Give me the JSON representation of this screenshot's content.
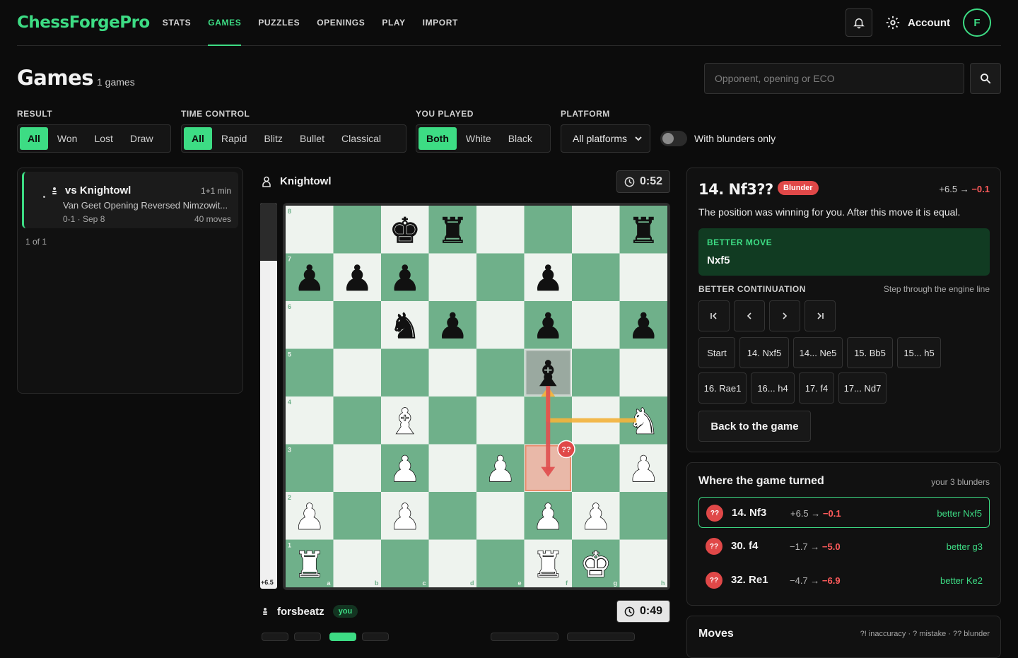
{
  "app": {
    "logo": "ChessForgePro",
    "nav": [
      "STATS",
      "GAMES",
      "PUZZLES",
      "OPENINGS",
      "PLAY",
      "IMPORT"
    ],
    "active_nav": "GAMES",
    "account_label": "Account",
    "avatar_initial": "F",
    "accent": "#3ddc84"
  },
  "page": {
    "title": "Games",
    "count": "1 games",
    "search_placeholder": "Opponent, opening or ECO"
  },
  "filters": {
    "result": {
      "label": "RESULT",
      "options": [
        "All",
        "Won",
        "Lost",
        "Draw"
      ],
      "active": "All"
    },
    "time_control": {
      "label": "TIME CONTROL",
      "options": [
        "All",
        "Rapid",
        "Blitz",
        "Bullet",
        "Classical"
      ],
      "active": "All"
    },
    "you_played": {
      "label": "YOU PLAYED",
      "options": [
        "Both",
        "White",
        "Black"
      ],
      "active": "Both"
    },
    "platform": {
      "label": "PLATFORM",
      "value": "All platforms"
    },
    "blunders_toggle": {
      "label": "With blunders only",
      "on": false
    }
  },
  "games_list": {
    "items": [
      {
        "title": "vs Knightowl",
        "time_control": "1+1 min",
        "opening": "Van Geet Opening Reversed Nimzowit...",
        "meta": "0-1 · Sep 8",
        "moves": "40 moves"
      }
    ],
    "pager": "1 of 1"
  },
  "board": {
    "top_player": {
      "name": "Knightowl",
      "clock": "0:52"
    },
    "bottom_player": {
      "name": "forsbeatz",
      "badge": "you",
      "clock": "0:49"
    },
    "eval_label": "+6.5",
    "eval_white_fraction": 0.85,
    "files": [
      "a",
      "b",
      "c",
      "d",
      "e",
      "f",
      "g",
      "h"
    ],
    "ranks": [
      "8",
      "7",
      "6",
      "5",
      "4",
      "3",
      "2",
      "1"
    ],
    "pieces": [
      {
        "sq": "c8",
        "p": "k"
      },
      {
        "sq": "d8",
        "p": "r"
      },
      {
        "sq": "h8",
        "p": "r"
      },
      {
        "sq": "a7",
        "p": "p"
      },
      {
        "sq": "b7",
        "p": "p"
      },
      {
        "sq": "c7",
        "p": "p"
      },
      {
        "sq": "f7",
        "p": "p"
      },
      {
        "sq": "c6",
        "p": "n"
      },
      {
        "sq": "d6",
        "p": "p"
      },
      {
        "sq": "f6",
        "p": "p"
      },
      {
        "sq": "h6",
        "p": "p"
      },
      {
        "sq": "f5",
        "p": "b"
      },
      {
        "sq": "c4",
        "p": "B"
      },
      {
        "sq": "h4",
        "p": "N"
      },
      {
        "sq": "c3",
        "p": "P"
      },
      {
        "sq": "e3",
        "p": "P"
      },
      {
        "sq": "h3",
        "p": "P"
      },
      {
        "sq": "a2",
        "p": "P"
      },
      {
        "sq": "c2",
        "p": "P"
      },
      {
        "sq": "f2",
        "p": "P"
      },
      {
        "sq": "g2",
        "p": "P"
      },
      {
        "sq": "a1",
        "p": "R"
      },
      {
        "sq": "f1",
        "p": "R"
      },
      {
        "sq": "g1",
        "p": "K"
      }
    ],
    "highlight_from": "f5",
    "highlight_to": "f3",
    "blunder_marker": "??",
    "arrows": [
      {
        "from": "h4",
        "to": "f5",
        "color": "#f2b33d",
        "kind": "knight"
      },
      {
        "from": "f5",
        "to": "f3",
        "color": "#e05050",
        "kind": "straight"
      }
    ],
    "light_sq": "#eef3ee",
    "dark_sq": "#6fb08a"
  },
  "analysis": {
    "move": "14. Nf3??",
    "badge": "Blunder",
    "eval_before": "+6.5 →",
    "eval_after": "−0.1",
    "description": "The position was winning for you. After this move it is equal.",
    "better_label": "BETTER MOVE",
    "better_move": "Nxf5",
    "continuation_label": "BETTER CONTINUATION",
    "continuation_hint": "Step through the engine line",
    "nav_icons": [
      "first-icon",
      "prev-icon",
      "next-icon",
      "last-icon"
    ],
    "line": [
      "Start",
      "14. Nxf5",
      "14... Ne5",
      "15. Bb5",
      "15... h5",
      "16. Rae1",
      "16... h4",
      "17. f4",
      "17... Nd7"
    ],
    "back_label": "Back to the game"
  },
  "turned": {
    "title": "Where the game turned",
    "hint": "your 3 blunders",
    "rows": [
      {
        "marker": "??",
        "move": "14. Nf3",
        "before": "+6.5 →",
        "after": "−0.1",
        "better": "better Nxf5",
        "active": true
      },
      {
        "marker": "??",
        "move": "30. f4",
        "before": "−1.7 →",
        "after": "−5.0",
        "better": "better g3",
        "active": false
      },
      {
        "marker": "??",
        "move": "32. Re1",
        "before": "−4.7 →",
        "after": "−6.9",
        "better": "better Ke2",
        "active": false
      }
    ]
  },
  "moves_panel": {
    "title": "Moves",
    "hint": "?! inaccuracy · ? mistake · ?? blunder"
  }
}
